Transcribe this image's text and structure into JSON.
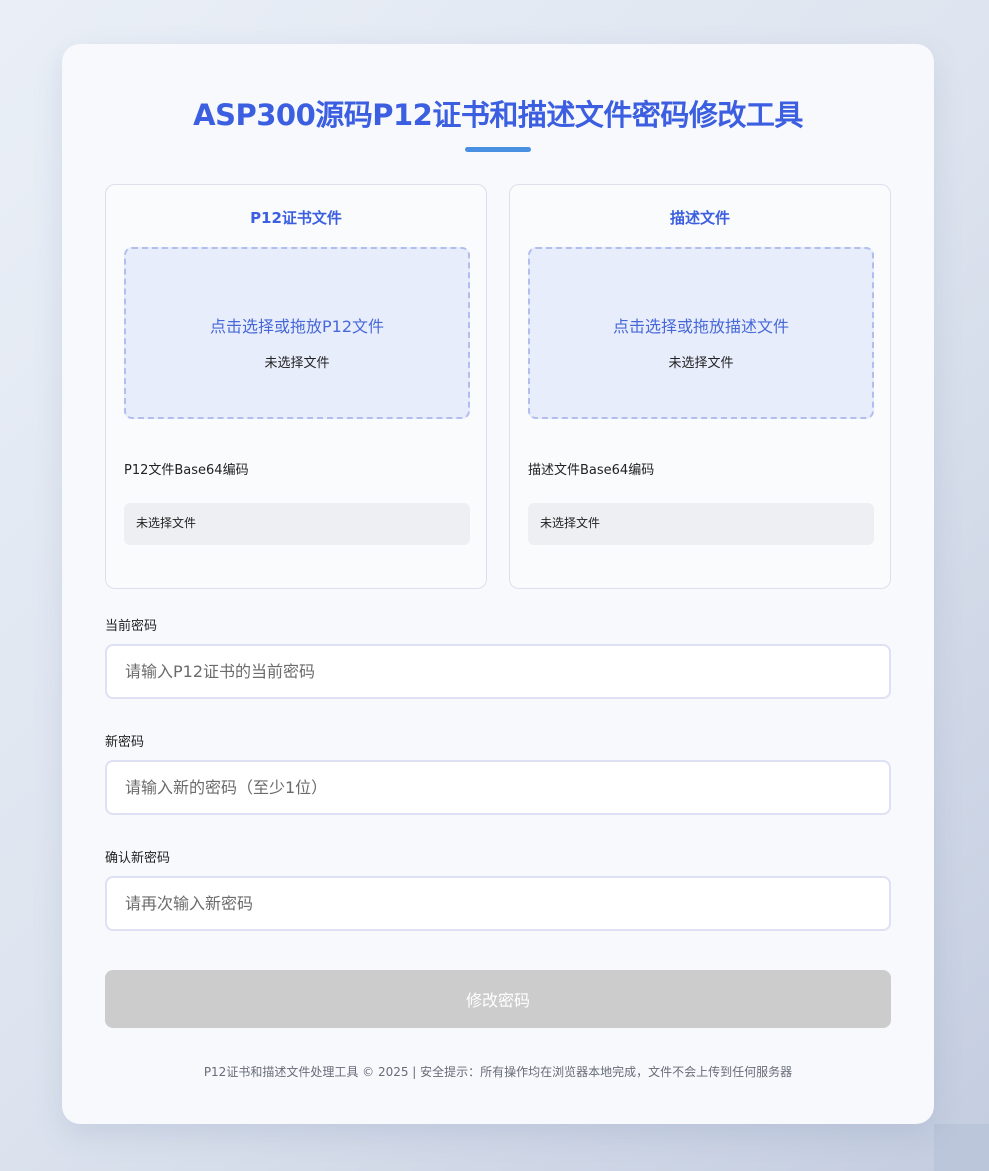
{
  "header": {
    "title": "ASP300源码P12证书和描述文件密码修改工具"
  },
  "p12_panel": {
    "title": "P12证书文件",
    "drop_text": "点击选择或拖放P12文件",
    "file_status": "未选择文件",
    "b64_label": "P12文件Base64编码",
    "b64_value": "未选择文件"
  },
  "profile_panel": {
    "title": "描述文件",
    "drop_text": "点击选择或拖放描述文件",
    "file_status": "未选择文件",
    "b64_label": "描述文件Base64编码",
    "b64_value": "未选择文件"
  },
  "form": {
    "current_password": {
      "label": "当前密码",
      "placeholder": "请输入P12证书的当前密码"
    },
    "new_password": {
      "label": "新密码",
      "placeholder": "请输入新的密码（至少1位）"
    },
    "confirm_password": {
      "label": "确认新密码",
      "placeholder": "请再次输入新密码"
    },
    "submit_label": "修改密码"
  },
  "footer": {
    "text": "P12证书和描述文件处理工具 © 2025 | 安全提示：所有操作均在浏览器本地完成，文件不会上传到任何服务器"
  },
  "colors": {
    "accent": "#3b5fe0",
    "title_bar": "#4a90e2",
    "drop_zone_bg": "#e8edfc",
    "disabled_button": "#cccccc"
  }
}
